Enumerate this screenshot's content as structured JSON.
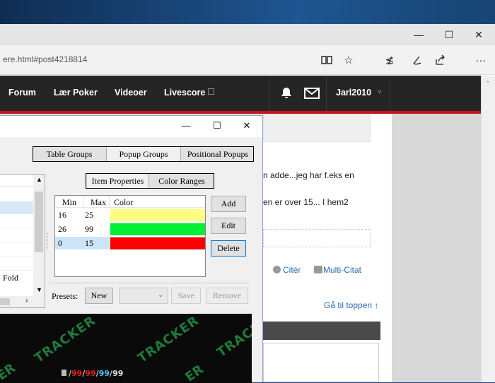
{
  "browser": {
    "url": "ere.html#post4218814",
    "controls": {
      "minimize": "—",
      "maximize": "☐",
      "close": "✕"
    },
    "toolbar_icons": [
      "reading-view-icon",
      "favorite-star-icon",
      "favorites-list-icon",
      "pen-icon",
      "share-icon",
      "more-icon"
    ]
  },
  "site": {
    "nav": [
      "Forum",
      "Lær Poker",
      "Videoer",
      "Livescore"
    ],
    "user": "Jarl2010",
    "user_caret": "˅",
    "post_line1": "n adde...jeg har f.eks en",
    "post_line2": "en er over 15... I hem2",
    "quote_label": "Citér",
    "multiquote_label": "Multi-Citat",
    "to_top": "Gå til toppen ↑"
  },
  "popup": {
    "controls": {
      "minimize": "—",
      "maximize": "☐",
      "close": "✕"
    },
    "group_tabs": [
      "Table Groups",
      "Popup Groups",
      "Positional Popups"
    ],
    "prop_tabs": [
      "Item Properties",
      "Color Ranges"
    ],
    "list_item": "Fold",
    "table": {
      "headers": [
        "Min",
        "Max",
        "Color"
      ],
      "rows": [
        {
          "min": "16",
          "max": "25",
          "color": "#ffff80"
        },
        {
          "min": "26",
          "max": "99",
          "color": "#00ee33"
        },
        {
          "min": "0",
          "max": "15",
          "color": "#ff0000"
        }
      ]
    },
    "buttons": {
      "add": "Add",
      "edit": "Edit",
      "delete": "Delete"
    },
    "presets": {
      "label": "Presets:",
      "new": "New",
      "save": "Save",
      "remove": "Remove"
    },
    "preview": {
      "watermark": "TRACKER",
      "watermark_part": "ER",
      "stats": [
        "99",
        "99",
        "99",
        "99"
      ],
      "sep": "/"
    }
  }
}
